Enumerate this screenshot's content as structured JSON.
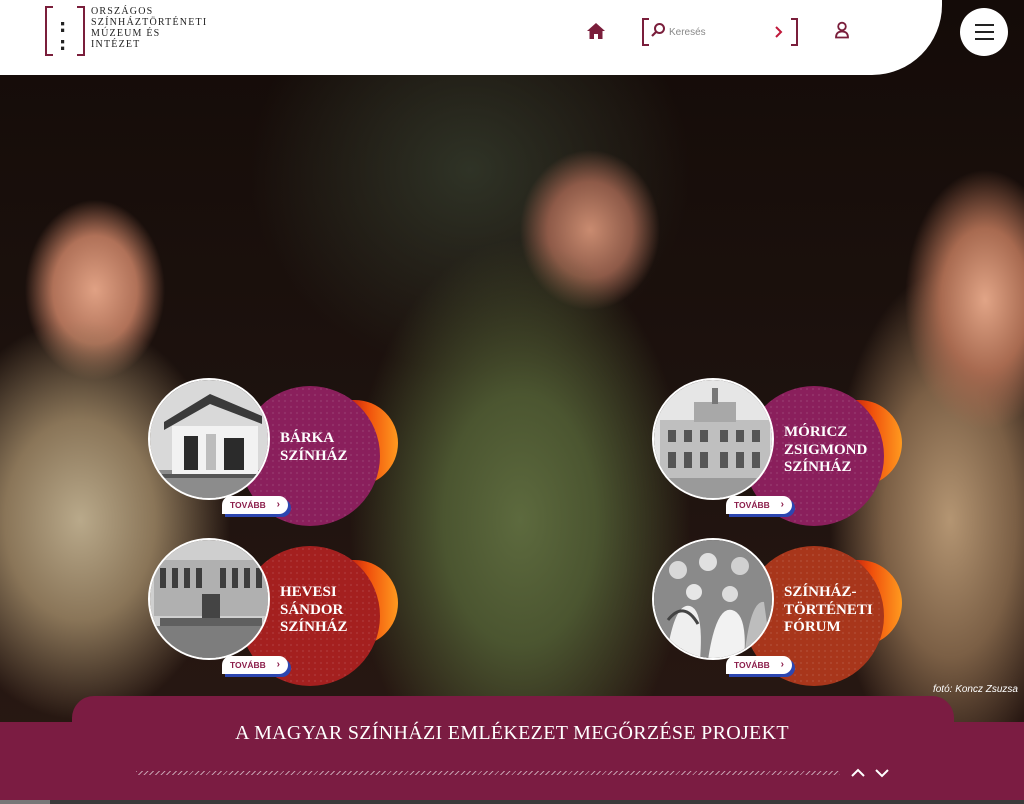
{
  "header": {
    "logo_lines": [
      "Országos",
      "Színháztörténeti",
      "Múzeum és",
      "Intézet"
    ],
    "search": {
      "placeholder": "Keresés",
      "value": ""
    },
    "icons": [
      "home-icon",
      "search-icon",
      "chevron-right-icon",
      "user-icon",
      "hamburger-menu-icon"
    ]
  },
  "cards": [
    {
      "title_lines": [
        "Bárka",
        "színház"
      ],
      "more_label": "TOVÁBB"
    },
    {
      "title_lines": [
        "Móricz",
        "Zsigmond",
        "színház"
      ],
      "more_label": "TOVÁBB"
    },
    {
      "title_lines": [
        "Hevesi",
        "Sándor",
        "színház"
      ],
      "more_label": "TOVÁBB"
    },
    {
      "title_lines": [
        "Színház-",
        "történeti",
        "fórum"
      ],
      "more_label": "TOVÁBB"
    }
  ],
  "photo_credit": "fotó: Koncz Zsuzsa",
  "banner": {
    "title": "A MAGYAR SZÍNHÁZI EMLÉKEZET MEGŐRZÉSE PROJEKT",
    "icons": [
      "chevron-up-icon",
      "chevron-down-icon"
    ]
  },
  "colors": {
    "brand": "#7b1c42",
    "card_purple": "#8a1f5c",
    "card_red": "#a4201f",
    "card_rust": "#a8361b",
    "accent_orange": "#f0500c"
  }
}
